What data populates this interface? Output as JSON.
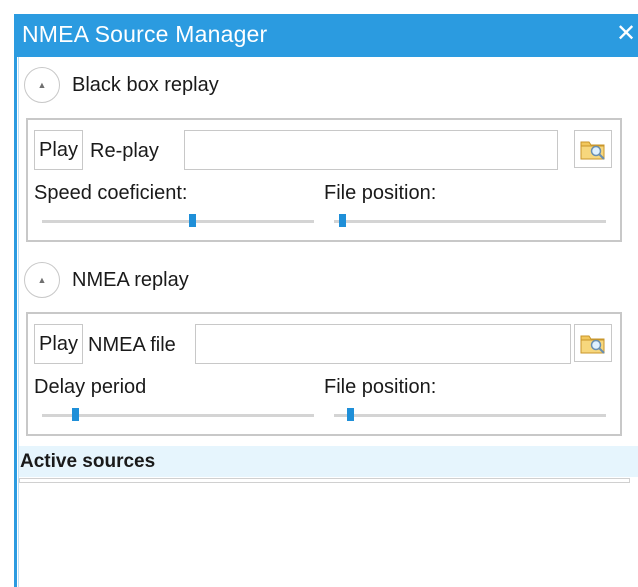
{
  "window": {
    "title": "NMEA Source Manager",
    "close_glyph": "✕",
    "accent_color": "#2b9be0"
  },
  "black_box": {
    "expander_glyph": "▲",
    "header_label": "Black box replay",
    "play_label": "Play",
    "file_label": "Re-play",
    "file_value": "",
    "speed_label": "Speed coeficient:",
    "speed_value": 0.55,
    "position_label": "File position:",
    "position_value": 0.03,
    "browse_icon": "folder-search-icon"
  },
  "nmea": {
    "expander_glyph": "▲",
    "header_label": "NMEA replay",
    "play_label": "Play",
    "file_label": "NMEA file",
    "file_value": "",
    "delay_label": "Delay period",
    "delay_value": 0.12,
    "position_label": "File position:",
    "position_value": 0.06,
    "browse_icon": "folder-search-icon"
  },
  "active_sources": {
    "header": "Active sources"
  }
}
